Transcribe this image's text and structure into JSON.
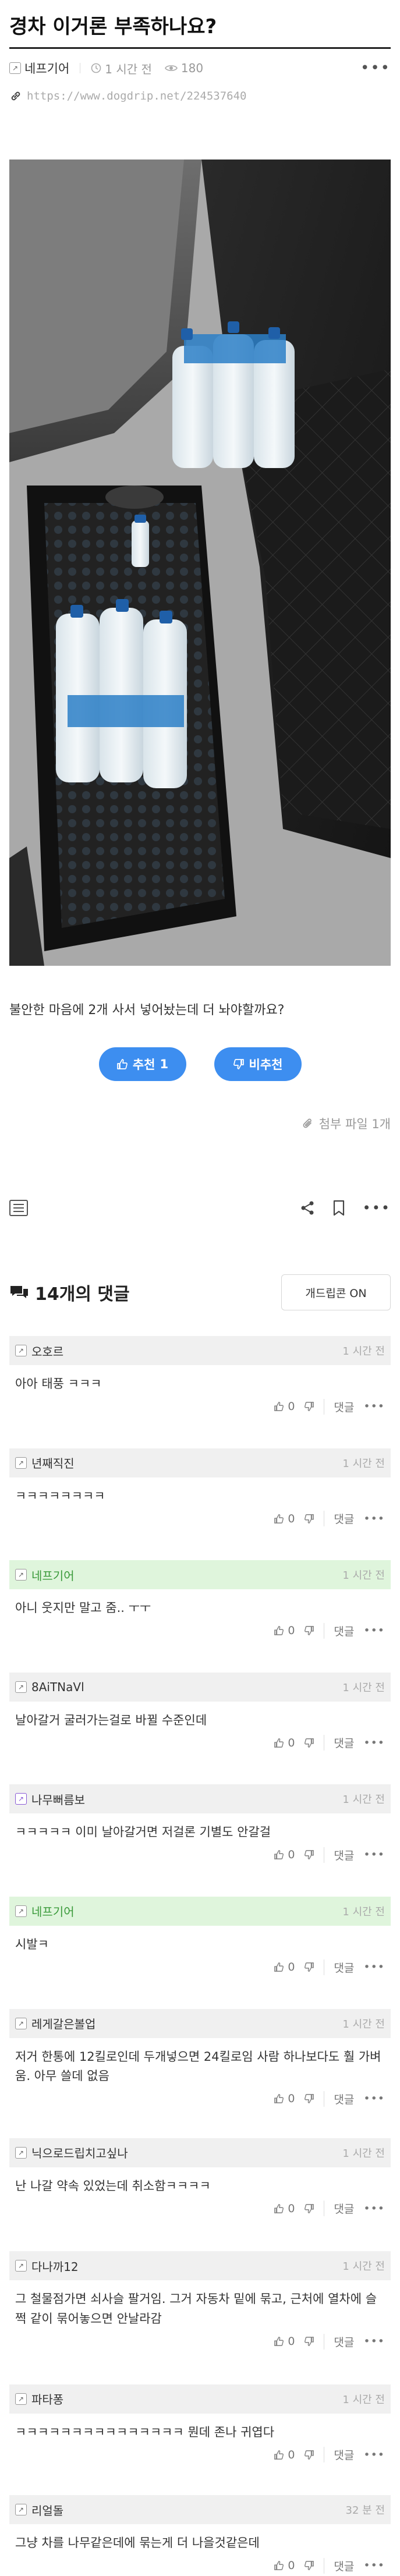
{
  "post": {
    "title": "경차 이거론 부족하나요?",
    "author": "네프기어",
    "time": "1 시간 전",
    "views": "180",
    "url": "https://www.dogdrip.net/224537640",
    "body": "불안한 마음에 2개 사서 넣어놨는데 더 놔야할까요?",
    "upvote_label": "추천",
    "upvote_count": "1",
    "downvote_label": "비추천",
    "attachment_label": "첨부 파일 1개"
  },
  "comments_section": {
    "title": "14개의 댓글",
    "gadget_button": "개드립콘 ON",
    "reply_label": "댓글"
  },
  "comments": [
    {
      "user": "오호르",
      "time": "1 시간 전",
      "text": "아아 태풍 ㅋㅋㅋ",
      "likes": "0",
      "mine": false
    },
    {
      "user": "년째직진",
      "time": "1 시간 전",
      "text": "ㅋㅋㅋㅋㅋㅋㅋㅋ",
      "likes": "0",
      "mine": false
    },
    {
      "user": "네프기어",
      "time": "1 시간 전",
      "text": "아니 웃지만 말고 줌.. ㅜㅜ",
      "likes": "0",
      "mine": true
    },
    {
      "user": "8AiTNaVl",
      "time": "1 시간 전",
      "text": "날아갈거 굴러가는걸로 바뀔 수준인데",
      "likes": "0",
      "mine": false
    },
    {
      "user": "나무뻐름보",
      "time": "1 시간 전",
      "text": "ㅋㅋㅋㅋㅋ 이미 날아갈거면 저걸론 기별도 안갈걸",
      "likes": "0",
      "mine": false
    },
    {
      "user": "네프기어",
      "time": "1 시간 전",
      "text": "시발ㅋ",
      "likes": "0",
      "mine": true
    },
    {
      "user": "레게갈은볼업",
      "time": "1 시간 전",
      "text": "저거 한통에 12킬로인데 두개넣으면 24킬로임 사람 하나보다도 훨 가벼움. 아무 쓸데 없음",
      "likes": "0",
      "mine": false
    },
    {
      "user": "닉으로드립치고싶나",
      "time": "1 시간 전",
      "text": "난 나갈 약속 있었는데 취소함ㅋㅋㅋㅋ",
      "likes": "0",
      "mine": false
    },
    {
      "user": "다나까12",
      "time": "1 시간 전",
      "text": "그 철물점가면 쇠사슬 팔거임. 그거 자동차 밑에 묶고, 근처에 열차에 슬쩍 같이 묶어놓으면 안날라감",
      "likes": "0",
      "mine": false
    },
    {
      "user": "파타퐁",
      "time": "1 시간 전",
      "text": "ㅋㅋㅋㅋㅋㅋㅋㅋㅋㅋㅋㅋㅋㅋㅋ 뭔데 존나 귀엽다",
      "likes": "0",
      "mine": false
    },
    {
      "user": "리얼돌",
      "time": "32 분 전",
      "text": "그냥 차를 나무같은데에 묶는게 더 나을것같은데",
      "likes": "0",
      "mine": false
    }
  ],
  "icons": {
    "clock": "clock-icon",
    "eye": "eye-icon",
    "link": "link-icon",
    "thumb_up": "thumbs-up-icon",
    "thumb_down": "thumbs-down-icon",
    "paperclip": "paperclip-icon",
    "list": "list-icon",
    "share": "share-icon",
    "bookmark": "bookmark-icon",
    "more": "more-icon",
    "comments": "comments-icon"
  },
  "colors": {
    "accent": "#3d8ef0",
    "mine_comment_bg": "#dff5dc",
    "comment_head_bg": "#f0f0f0"
  }
}
